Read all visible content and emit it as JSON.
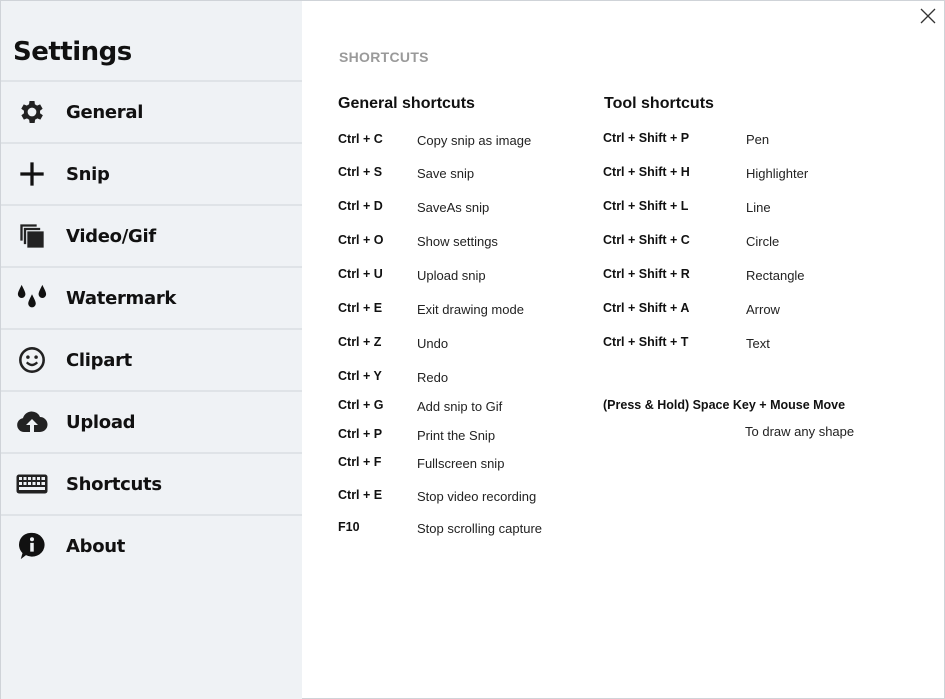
{
  "window": {
    "close_icon": "close-icon"
  },
  "sidebar": {
    "title": "Settings",
    "items": [
      {
        "label": "General",
        "icon": "gear-icon"
      },
      {
        "label": "Snip",
        "icon": "plus-icon"
      },
      {
        "label": "Video/Gif",
        "icon": "stacked-squares-icon"
      },
      {
        "label": "Watermark",
        "icon": "droplets-icon"
      },
      {
        "label": "Clipart",
        "icon": "smiley-icon"
      },
      {
        "label": "Upload",
        "icon": "cloud-upload-icon"
      },
      {
        "label": "Shortcuts",
        "icon": "keyboard-icon"
      },
      {
        "label": "About",
        "icon": "info-bubble-icon"
      }
    ]
  },
  "main": {
    "section_title": "SHORTCUTS",
    "general": {
      "heading": "General shortcuts",
      "rows": [
        {
          "key": "Ctrl + C",
          "action": "Copy snip as image"
        },
        {
          "key": "Ctrl + S",
          "action": "Save snip"
        },
        {
          "key": "Ctrl + D",
          "action": "SaveAs snip"
        },
        {
          "key": "Ctrl + O",
          "action": "Show settings"
        },
        {
          "key": "Ctrl + U",
          "action": "Upload snip"
        },
        {
          "key": "Ctrl + E",
          "action": "Exit drawing mode"
        },
        {
          "key": "Ctrl + Z",
          "action": "Undo"
        },
        {
          "key": "Ctrl + Y",
          "action": "Redo"
        },
        {
          "key": "Ctrl + G",
          "action": "Add snip to Gif"
        },
        {
          "key": "Ctrl + P",
          "action": "Print the Snip"
        },
        {
          "key": "Ctrl + F",
          "action": "Fullscreen snip"
        },
        {
          "key": "Ctrl + E",
          "action": "Stop video recording"
        },
        {
          "key": "F10",
          "action": "Stop scrolling capture"
        }
      ]
    },
    "tools": {
      "heading": "Tool shortcuts",
      "rows": [
        {
          "key": "Ctrl + Shift + P",
          "action": "Pen"
        },
        {
          "key": "Ctrl + Shift + H",
          "action": "Highlighter"
        },
        {
          "key": "Ctrl + Shift + L",
          "action": "Line"
        },
        {
          "key": "Ctrl + Shift + C",
          "action": "Circle"
        },
        {
          "key": "Ctrl + Shift + R",
          "action": "Rectangle"
        },
        {
          "key": "Ctrl + Shift + A",
          "action": "Arrow"
        },
        {
          "key": "Ctrl + Shift + T",
          "action": "Text"
        }
      ],
      "special_key": "(Press & Hold) Space Key + Mouse Move",
      "special_action": "To draw any shape"
    }
  }
}
